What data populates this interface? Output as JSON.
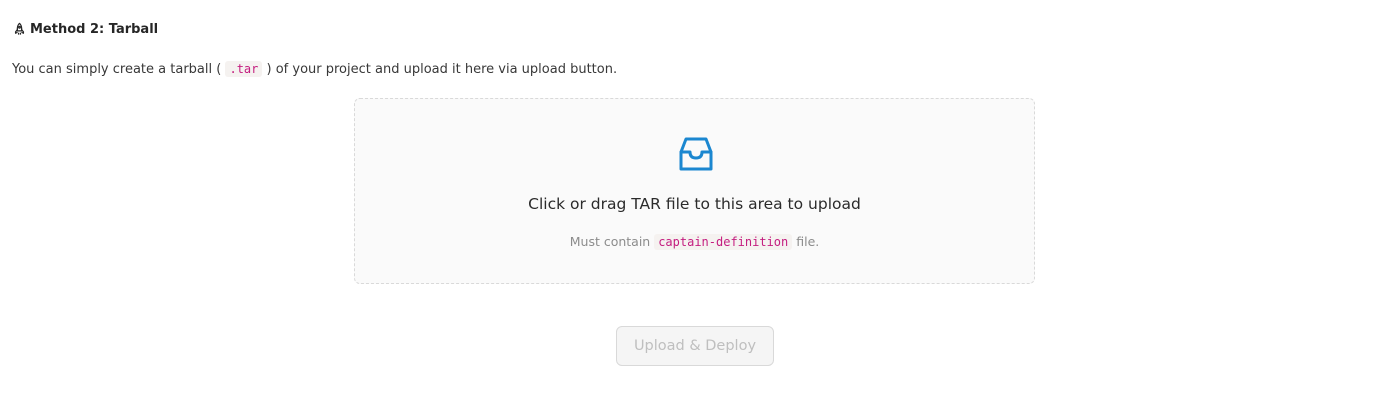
{
  "section": {
    "title": "Method 2: Tarball",
    "icon": "rocket-icon"
  },
  "description": {
    "before": "You can simply create a tarball (",
    "code": ".tar",
    "after": ") of your project and upload it here via upload button."
  },
  "dropzone": {
    "icon": "inbox-icon",
    "text": "Click or drag TAR file to this area to upload",
    "hint_before": "Must contain ",
    "hint_code": "captain-definition",
    "hint_after": " file."
  },
  "upload_button": {
    "label": "Upload & Deploy",
    "disabled": true
  },
  "colors": {
    "accent": "#1b87d0",
    "code_text": "#c41d7f",
    "dropzone_bg": "#fafafa",
    "disabled_text": "#bfbfbf"
  }
}
